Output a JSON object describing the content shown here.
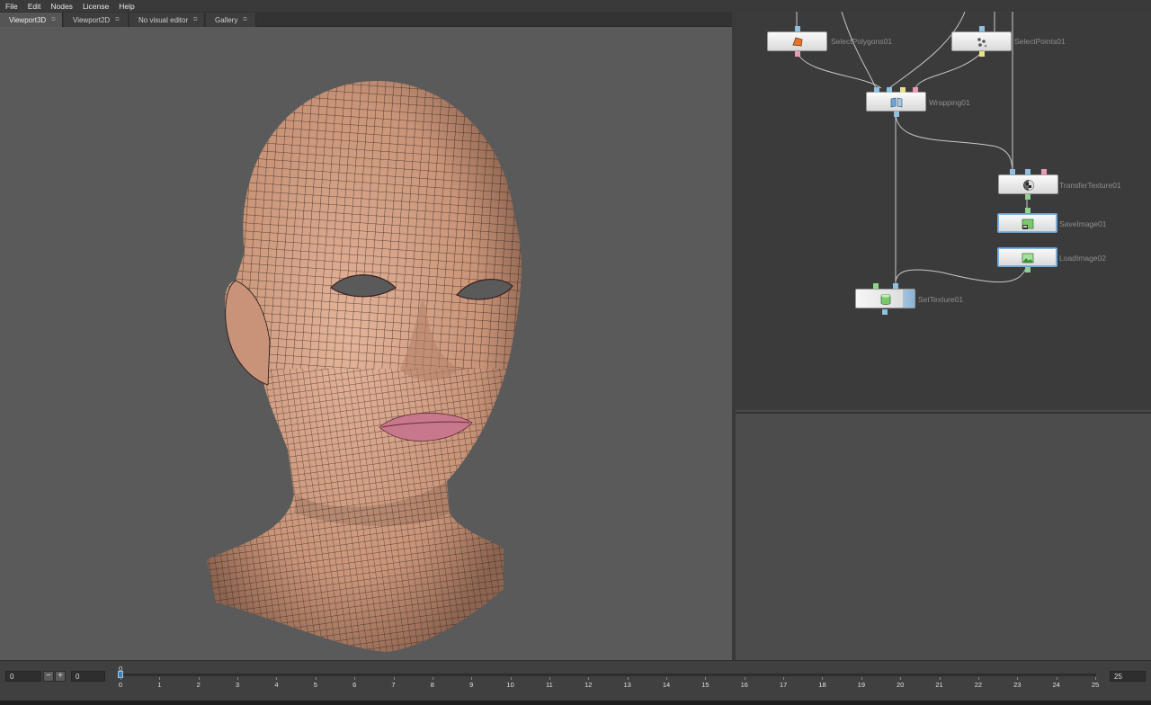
{
  "menu": [
    "File",
    "Edit",
    "Nodes",
    "License",
    "Help"
  ],
  "tabs": [
    {
      "label": "Viewport3D",
      "active": true
    },
    {
      "label": "Viewport2D",
      "active": false
    },
    {
      "label": "No visual editor",
      "active": false
    },
    {
      "label": "Gallery",
      "active": false
    }
  ],
  "nodes": {
    "select_polygons": "SelectPolygons01",
    "select_points": "SelectPoints01",
    "wrapping": "Wrapping01",
    "transfer_texture": "TransferTexture01",
    "save_image": "SaveImage01",
    "load_image": "LoadImage02",
    "set_texture": "SetTexture01"
  },
  "timeline": {
    "start_value": "0",
    "step_value": "0",
    "current_frame": "0",
    "end_value": "25",
    "minus_label": "−",
    "plus_label": "+",
    "ticks": [
      "0",
      "1",
      "2",
      "3",
      "4",
      "5",
      "6",
      "7",
      "8",
      "9",
      "10",
      "11",
      "12",
      "13",
      "14",
      "15",
      "16",
      "17",
      "18",
      "19",
      "20",
      "21",
      "22",
      "23",
      "24",
      "25"
    ]
  },
  "colors": {
    "skin": "#d8a58a",
    "wire": "#1b1410",
    "lips": "#c8788c",
    "port_blue": "#8ec0e0",
    "port_pink": "#e89ab8",
    "port_green": "#8fd38a",
    "port_yellow": "#e8e08a",
    "selected_node": "#6fa2cf"
  },
  "icons": {
    "select_polygons": "orange-polygon-icon",
    "select_points": "points-icon",
    "wrapping": "wrapping-icon",
    "transfer_texture": "transfer-texture-icon",
    "save_image": "save-image-icon",
    "load_image": "load-image-icon",
    "set_texture": "set-texture-icon"
  }
}
